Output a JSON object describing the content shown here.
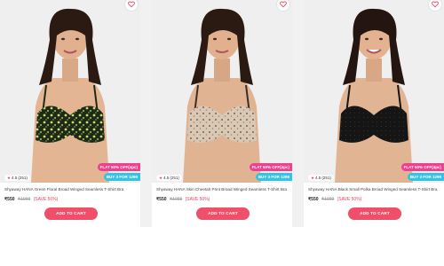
{
  "products": [
    {
      "rating": "4.5",
      "reviews": "(251)",
      "offer_flat": "FLAT 50% OFF(4pc)",
      "offer_buy": "BUY 3 FOR 1299",
      "title": "Shyaway HANA Green Floral Broad Winged Seamless T-Shirt Bra",
      "price": "₹550",
      "mrp": "₹1099",
      "save": "(SAVE 50%)",
      "cta": "ADD TO CART",
      "print_color": "#1c2a17",
      "print_accent": "#d6e07a"
    },
    {
      "rating": "4.5",
      "reviews": "(251)",
      "offer_flat": "FLAT 50% OFF(4pc)",
      "offer_buy": "BUY 3 FOR 1299",
      "title": "Shyaway HANA Skin Cheetah Print Broad Winged Seamless T-Shirt Bra",
      "price": "₹550",
      "mrp": "₹1099",
      "save": "(SAVE 50%)",
      "cta": "ADD TO CART",
      "print_color": "#d9c9b4",
      "print_accent": "#6b5a4a"
    },
    {
      "rating": "4.5",
      "reviews": "(251)",
      "offer_flat": "FLAT 50% OFF(4pc)",
      "offer_buy": "BUY 3 FOR 1299",
      "title": "Shyaway HANA Black Small Polka Broad Winged Seamless T-Shirt Bra",
      "price": "₹550",
      "mrp": "₹1099",
      "save": "(SAVE 50%)",
      "cta": "ADD TO CART",
      "print_color": "#151515",
      "print_accent": "#2f2f2f"
    }
  ],
  "icons": {
    "wishlist": "heart-outline-icon",
    "rating": "star-icon"
  },
  "colors": {
    "accent": "#ef4f69",
    "offer_flat": "#ef3f8f",
    "offer_buy": "#36c1e6",
    "page_bg": "#f1f1f1"
  }
}
